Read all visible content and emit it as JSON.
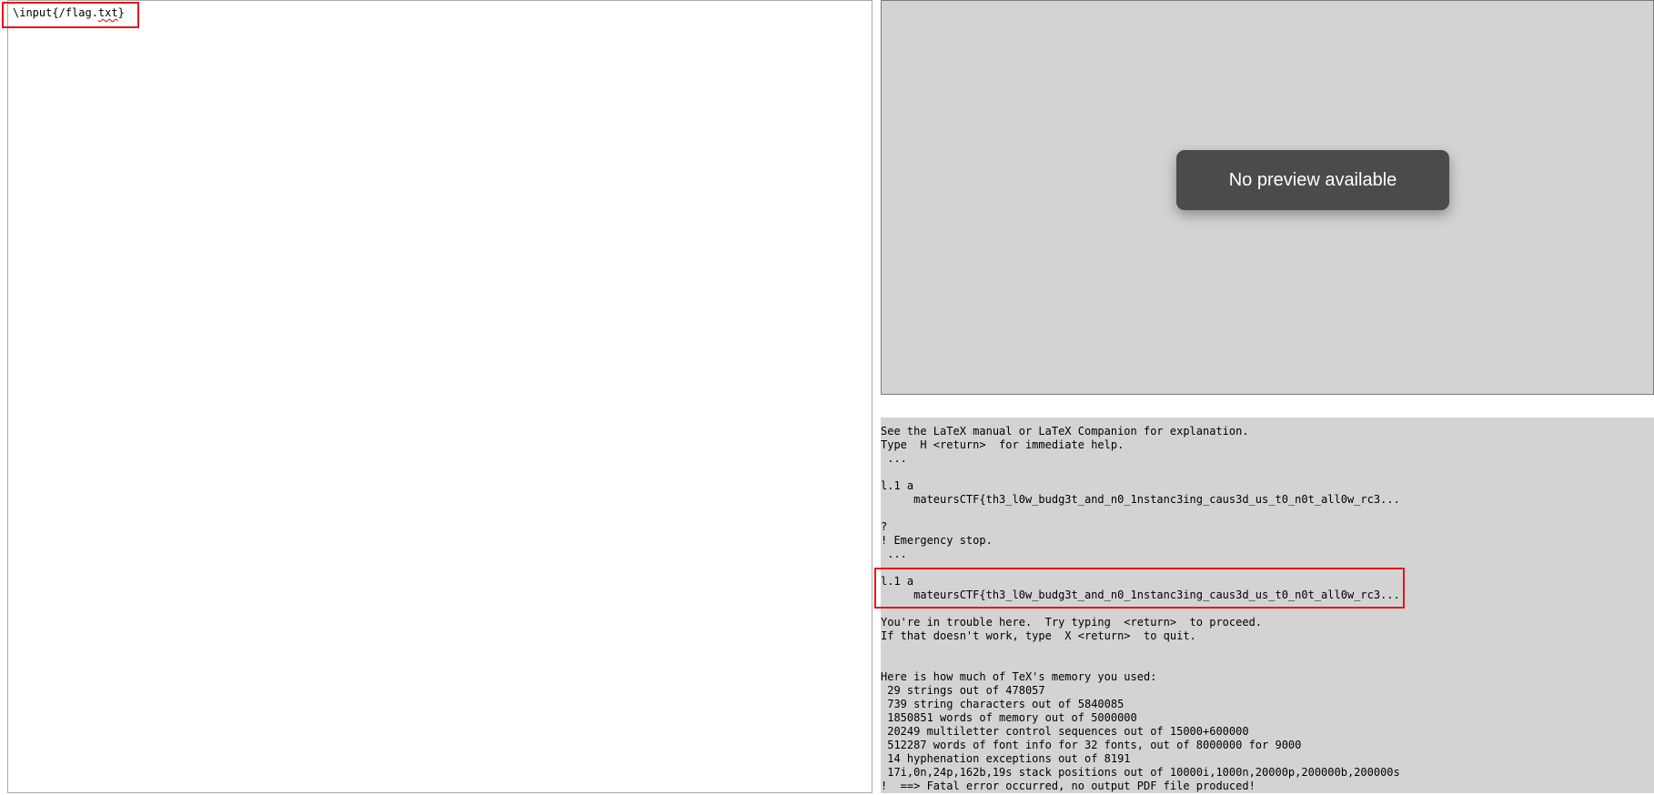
{
  "editor": {
    "prefix": "\\input{/flag.",
    "misspelled": "txt",
    "suffix": "}"
  },
  "preview": {
    "message": "No preview available"
  },
  "log": {
    "lines": [
      "See the LaTeX manual or LaTeX Companion for explanation.",
      "Type  H <return>  for immediate help.",
      " ...",
      "",
      "l.1 a",
      "     mateursCTF{th3_l0w_budg3t_and_n0_1nstanc3ing_caus3d_us_t0_n0t_all0w_rc3...",
      "",
      "?",
      "! Emergency stop.",
      " ...",
      "",
      "l.1 a",
      "     mateursCTF{th3_l0w_budg3t_and_n0_1nstanc3ing_caus3d_us_t0_n0t_all0w_rc3...",
      "",
      "You're in trouble here.  Try typing  <return>  to proceed.",
      "If that doesn't work, type  X <return>  to quit.",
      "",
      "",
      "Here is how much of TeX's memory you used:",
      " 29 strings out of 478057",
      " 739 string characters out of 5840085",
      " 1850851 words of memory out of 5000000",
      " 20249 multiletter control sequences out of 15000+600000",
      " 512287 words of font info for 32 fonts, out of 8000000 for 9000",
      " 14 hyphenation exceptions out of 8191",
      " 17i,0n,24p,162b,19s stack positions out of 10000i,1000n,20000p,200000b,200000s",
      "!  ==> Fatal error occurred, no output PDF file produced!"
    ]
  }
}
